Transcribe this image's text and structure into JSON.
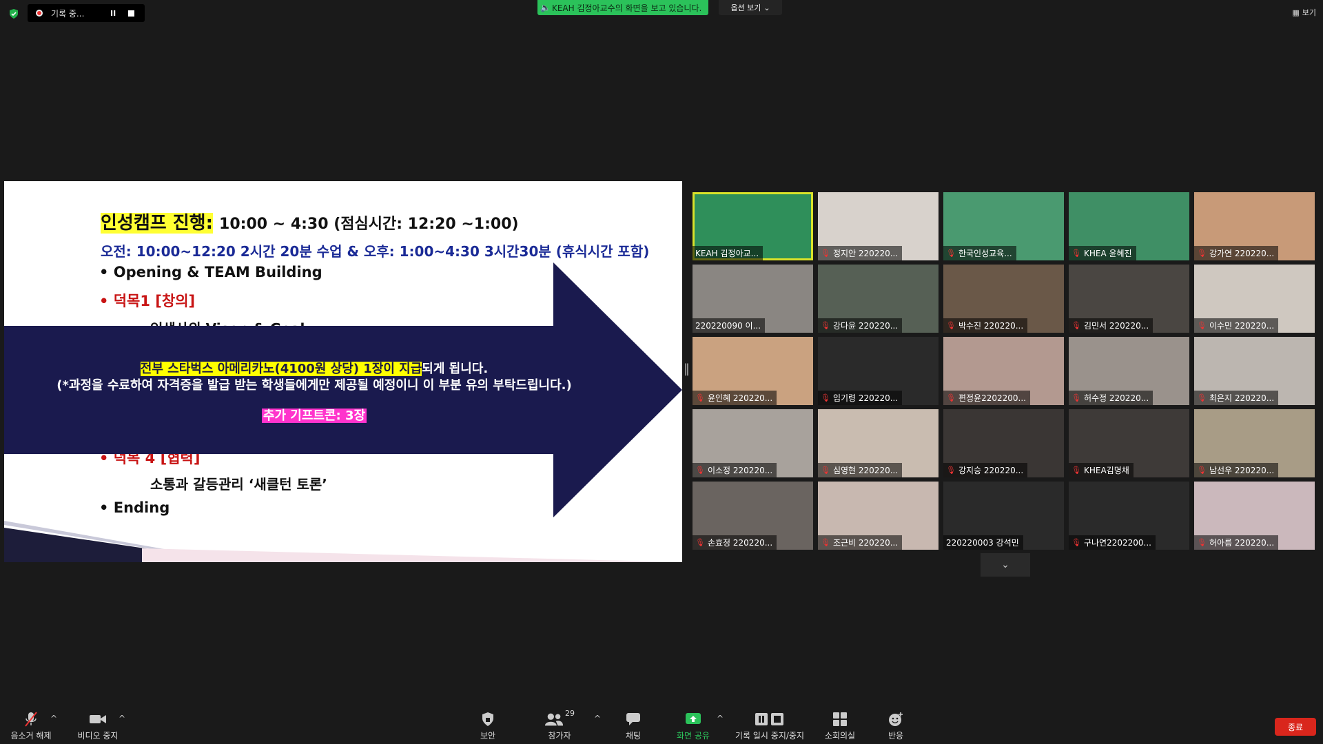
{
  "recording": {
    "label": "기록 중...",
    "pause": "II"
  },
  "share_banner": "KEAH 김정아교수의 화면을 보고 있습니다.",
  "view_options": "옵션 보기",
  "view_button": "보기",
  "slide": {
    "title_hl": "인성캠프 진행:",
    "title_rest": "10:00 ~ 4:30 (점심시간: 12:20 ~1:00)",
    "schedule": "오전: 10:00~12:20 2시간 20분 수업 & 오후: 1:00~4:30 3시간30분 (휴식시간 포함)",
    "bullet1": "• Opening & TEAM Building",
    "bullet2": "• 덕목1 [창의]",
    "partial_sub": "인생사의 Vison & Goal",
    "arrow_line1_hl": "전부 스타벅스 아메리카노(4100원 상당) 1장이 지급",
    "arrow_line1_rest": "되게 됩니다.",
    "arrow_line2": "(*과정을 수료하여 자격증을 발급 받는 학생들에게만 제공될 예정이니 이 부분 유의 부탁드립니다.)",
    "arrow_line3": "추가 기프트콘: 3장",
    "bullet_partial4": "• 덕목 4 [협력]",
    "sub4": "소통과 갈등관리   ‘새클턴 토론’",
    "bullet_end": "• Ending"
  },
  "participants": [
    {
      "name": "KEAH 김정아교...",
      "muted": false,
      "host": true
    },
    {
      "name": "정지안 220220...",
      "muted": true
    },
    {
      "name": "한국인성교육...",
      "muted": true
    },
    {
      "name": "KHEA 윤혜진",
      "muted": true
    },
    {
      "name": "강가연 220220...",
      "muted": true
    },
    {
      "name": "220220090 이...",
      "muted": false
    },
    {
      "name": "강다윤 220220...",
      "muted": true
    },
    {
      "name": "박수진 220220...",
      "muted": true
    },
    {
      "name": "김민서 220220...",
      "muted": true
    },
    {
      "name": "이수민 220220...",
      "muted": true
    },
    {
      "name": "윤인혜 220220...",
      "muted": true
    },
    {
      "name": "임기령 220220...",
      "muted": true
    },
    {
      "name": "편정윤2202200...",
      "muted": true
    },
    {
      "name": "허수정 220220...",
      "muted": true
    },
    {
      "name": "최은지 220220...",
      "muted": true
    },
    {
      "name": "이소정 220220...",
      "muted": true
    },
    {
      "name": "심영현 220220...",
      "muted": true
    },
    {
      "name": "강지승 220220...",
      "muted": true
    },
    {
      "name": "KHEA김명채",
      "muted": true
    },
    {
      "name": "남선우 220220...",
      "muted": true
    },
    {
      "name": "손효정 220220...",
      "muted": true
    },
    {
      "name": "조근비 220220...",
      "muted": true
    },
    {
      "name": "220220003 강석민",
      "muted": false
    },
    {
      "name": "구나연2202200...",
      "muted": true
    },
    {
      "name": "허아름 220220...",
      "muted": true
    }
  ],
  "toolbar": {
    "unmute": "음소거 해제",
    "video": "비디오 중지",
    "security": "보안",
    "participants": "참가자",
    "participant_count": "29",
    "chat": "채팅",
    "share": "화면 공유",
    "record": "기록 일시 중지/중지",
    "breakout": "소회의실",
    "reactions": "반응",
    "end": "종료"
  },
  "colors": {
    "share_green": "#2bc25a",
    "active_speaker": "#d9e22a",
    "end_red": "#d9261c",
    "slide_navy": "#1a1a4e"
  }
}
